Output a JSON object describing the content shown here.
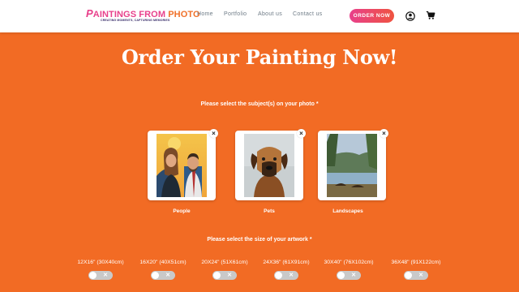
{
  "header": {
    "logo": {
      "first_letter": "P",
      "main": "AINTINGS FROM ",
      "photo": "PHOTO",
      "tagline": "CREATING MOMENTS, CAPTURING MEMORIES"
    },
    "nav": [
      "Home",
      "Portfolio",
      "About us",
      "Contact us"
    ],
    "order_button": "ORDER NOW",
    "icons": [
      "user-icon",
      "cart-icon"
    ]
  },
  "main": {
    "title": "Order Your Painting Now!",
    "subject_prompt": "Please select the subject(s) on your photo *",
    "subjects": [
      {
        "label": "People",
        "remove": "×"
      },
      {
        "label": "Pets",
        "remove": "×"
      },
      {
        "label": "Landscapes",
        "remove": "×"
      }
    ],
    "size_prompt": "Please select the size of your artwork *",
    "sizes": [
      {
        "label": "12X16\" (30X40cm)",
        "toggle": "✕"
      },
      {
        "label": "16X20\" (40X51cm)",
        "toggle": "✕"
      },
      {
        "label": "20X24\" (51X61cm)",
        "toggle": "✕"
      },
      {
        "label": "24X36\" (61X91cm)",
        "toggle": "✕"
      },
      {
        "label": "30X40\" (76X102cm)",
        "toggle": "✕"
      },
      {
        "label": "36X48\" (91X122cm)",
        "toggle": "✕"
      }
    ]
  },
  "colors": {
    "background": "#f26b24",
    "brand_pink": "#e8408b",
    "brand_orange": "#f0712a",
    "toggle_off": "#c9c9c9"
  }
}
